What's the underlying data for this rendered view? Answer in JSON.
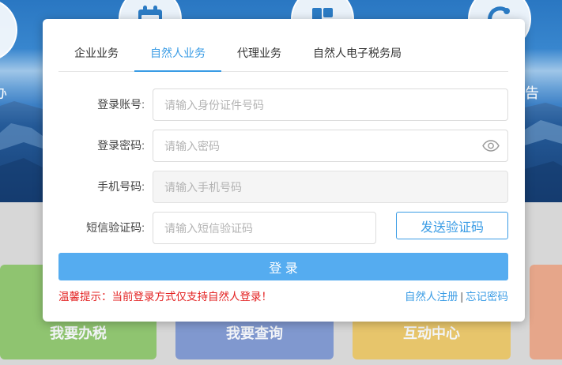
{
  "background": {
    "left_edge_label": "办",
    "right_edge_label": "告",
    "banner_icons": [
      "calendar-icon",
      "grid-icon",
      "refresh-icon"
    ],
    "tiles": [
      {
        "label": "我要办税",
        "color": "#8fc470"
      },
      {
        "label": "我要查询",
        "color": "#8098cf"
      },
      {
        "label": "互动中心",
        "color": "#e7c56b"
      },
      {
        "color": "#e6a68a"
      }
    ]
  },
  "login_dialog": {
    "accent_color": "#3a9ce5",
    "tabs": [
      {
        "label": "企业业务",
        "active": false
      },
      {
        "label": "自然人业务",
        "active": true
      },
      {
        "label": "代理业务",
        "active": false
      },
      {
        "label": "自然人电子税务局",
        "active": false
      }
    ],
    "account": {
      "label": "登录账号:",
      "placeholder": "请输入身份证件号码",
      "value": ""
    },
    "password": {
      "label": "登录密码:",
      "placeholder": "请输入密码",
      "value": "",
      "toggle_icon": "eye-icon"
    },
    "mobile": {
      "label": "手机号码:",
      "placeholder": "请输入手机号码",
      "value": "",
      "disabled": true
    },
    "sms_code": {
      "label": "短信验证码:",
      "placeholder": "请输入短信验证码",
      "value": "",
      "send_button_label": "发送验证码"
    },
    "submit_label": "登 录",
    "submit_color": "#55acf0",
    "notice": {
      "text": "温馨提示：当前登录方式仅支持自然人登录！",
      "color": "#e32222"
    },
    "links": {
      "register": "自然人注册",
      "separator": "|",
      "forgot_password": "忘记密码"
    }
  }
}
